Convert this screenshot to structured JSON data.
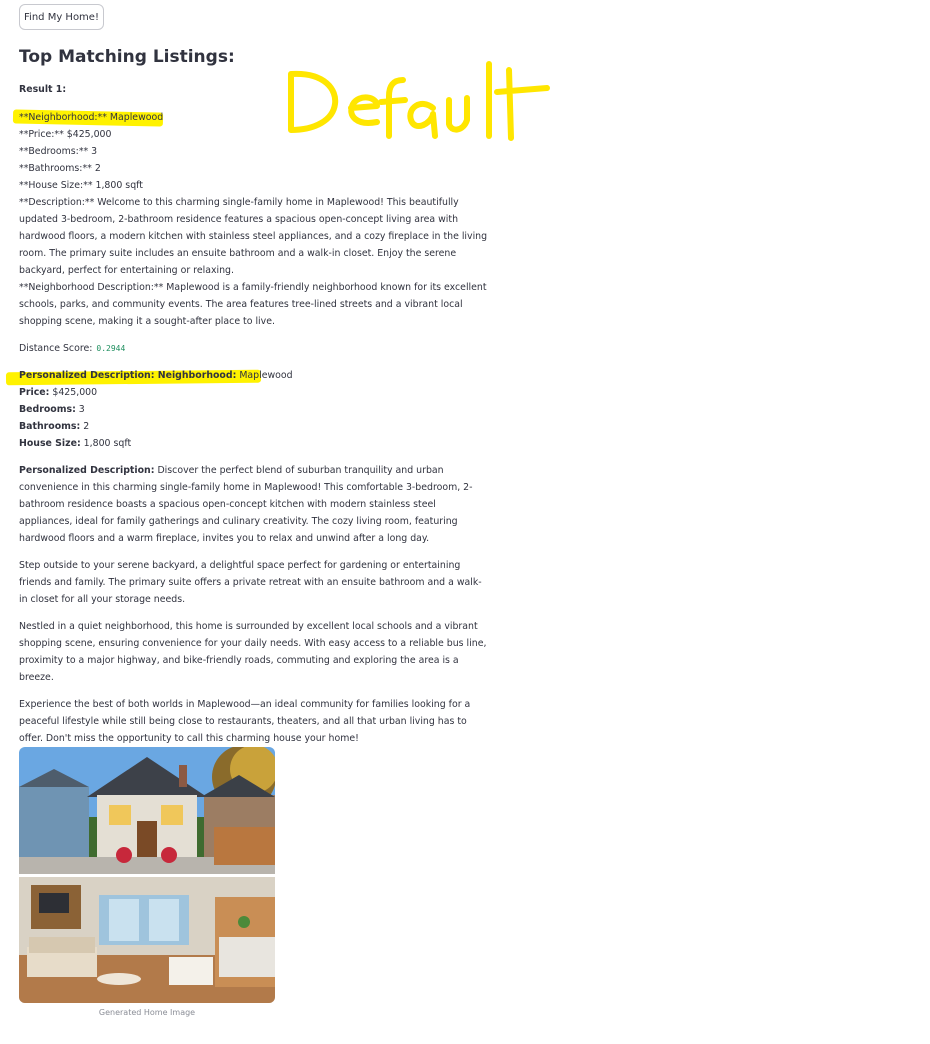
{
  "button": {
    "label": "Find My Home!"
  },
  "heading": "Top Matching Listings:",
  "result": {
    "label": "Result 1:",
    "raw": [
      "**Neighborhood:** Maplewood",
      "**Price:** $425,000",
      "**Bedrooms:** 3",
      "**Bathrooms:** 2",
      "**House Size:** 1,800 sqft",
      "**Description:** Welcome to this charming single-family home in Maplewood! This beautifully updated 3-bedroom, 2-bathroom residence features a spacious open-concept living area with hardwood floors, a modern kitchen with stainless steel appliances, and a cozy fireplace in the living room. The primary suite includes an ensuite bathroom and a walk-in closet. Enjoy the serene backyard, perfect for entertaining or relaxing.",
      "**Neighborhood Description:** Maplewood is a family-friendly neighborhood known for its excellent schools, parks, and community events. The area features tree-lined streets and a vibrant local shopping scene, making it a sought-after place to live."
    ],
    "distance_label": "Distance Score:",
    "distance_value": "0.2944"
  },
  "personalized": {
    "heading_bold": "Personalized Description: Neighborhood:",
    "heading_value": " Maplewood",
    "fields": [
      {
        "label": "Price:",
        "value": " $425,000"
      },
      {
        "label": "Bedrooms:",
        "value": " 3"
      },
      {
        "label": "Bathrooms:",
        "value": " 2"
      },
      {
        "label": "House Size:",
        "value": " 1,800 sqft"
      }
    ],
    "desc_label": "Personalized Description:",
    "desc_first": " Discover the perfect blend of suburban tranquility and urban convenience in this charming single-family home in Maplewood! This comfortable 3-bedroom, 2-bathroom residence boasts a spacious open-concept kitchen with modern stainless steel appliances, ideal for family gatherings and culinary creativity. The cozy living room, featuring hardwood floors and a warm fireplace, invites you to relax and unwind after a long day.",
    "paragraphs": [
      "Step outside to your serene backyard, a delightful space perfect for gardening or entertaining friends and family. The primary suite offers a private retreat with an ensuite bathroom and a walk-in closet for all your storage needs.",
      "Nestled in a quiet neighborhood, this home is surrounded by excellent local schools and a vibrant shopping scene, ensuring convenience for your daily needs. With easy access to a reliable bus line, proximity to a major highway, and bike-friendly roads, commuting and exploring the area is a breeze.",
      "Experience the best of both worlds in Maplewood—an ideal community for families looking for a peaceful lifestyle while still being close to restaurants, theaters, and all that urban living has to offer. Don't miss the opportunity to call this charming house your home!"
    ]
  },
  "image": {
    "caption": "Generated Home Image"
  },
  "annotation": {
    "text": "Default",
    "color": "#ffe600"
  },
  "colors": {
    "highlight": "#fff200",
    "score": "#1f8f5f"
  }
}
